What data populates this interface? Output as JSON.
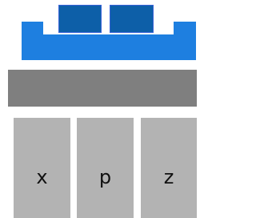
{
  "colors": {
    "tray": "#1e7fe0",
    "block_fill": "#0d5fa8",
    "block_border": "#3a63d8",
    "bar": "#7f7f7f",
    "column": "#b3b3b3",
    "label": "#111111"
  },
  "columns": [
    {
      "label": "x"
    },
    {
      "label": "p"
    },
    {
      "label": "z"
    }
  ]
}
